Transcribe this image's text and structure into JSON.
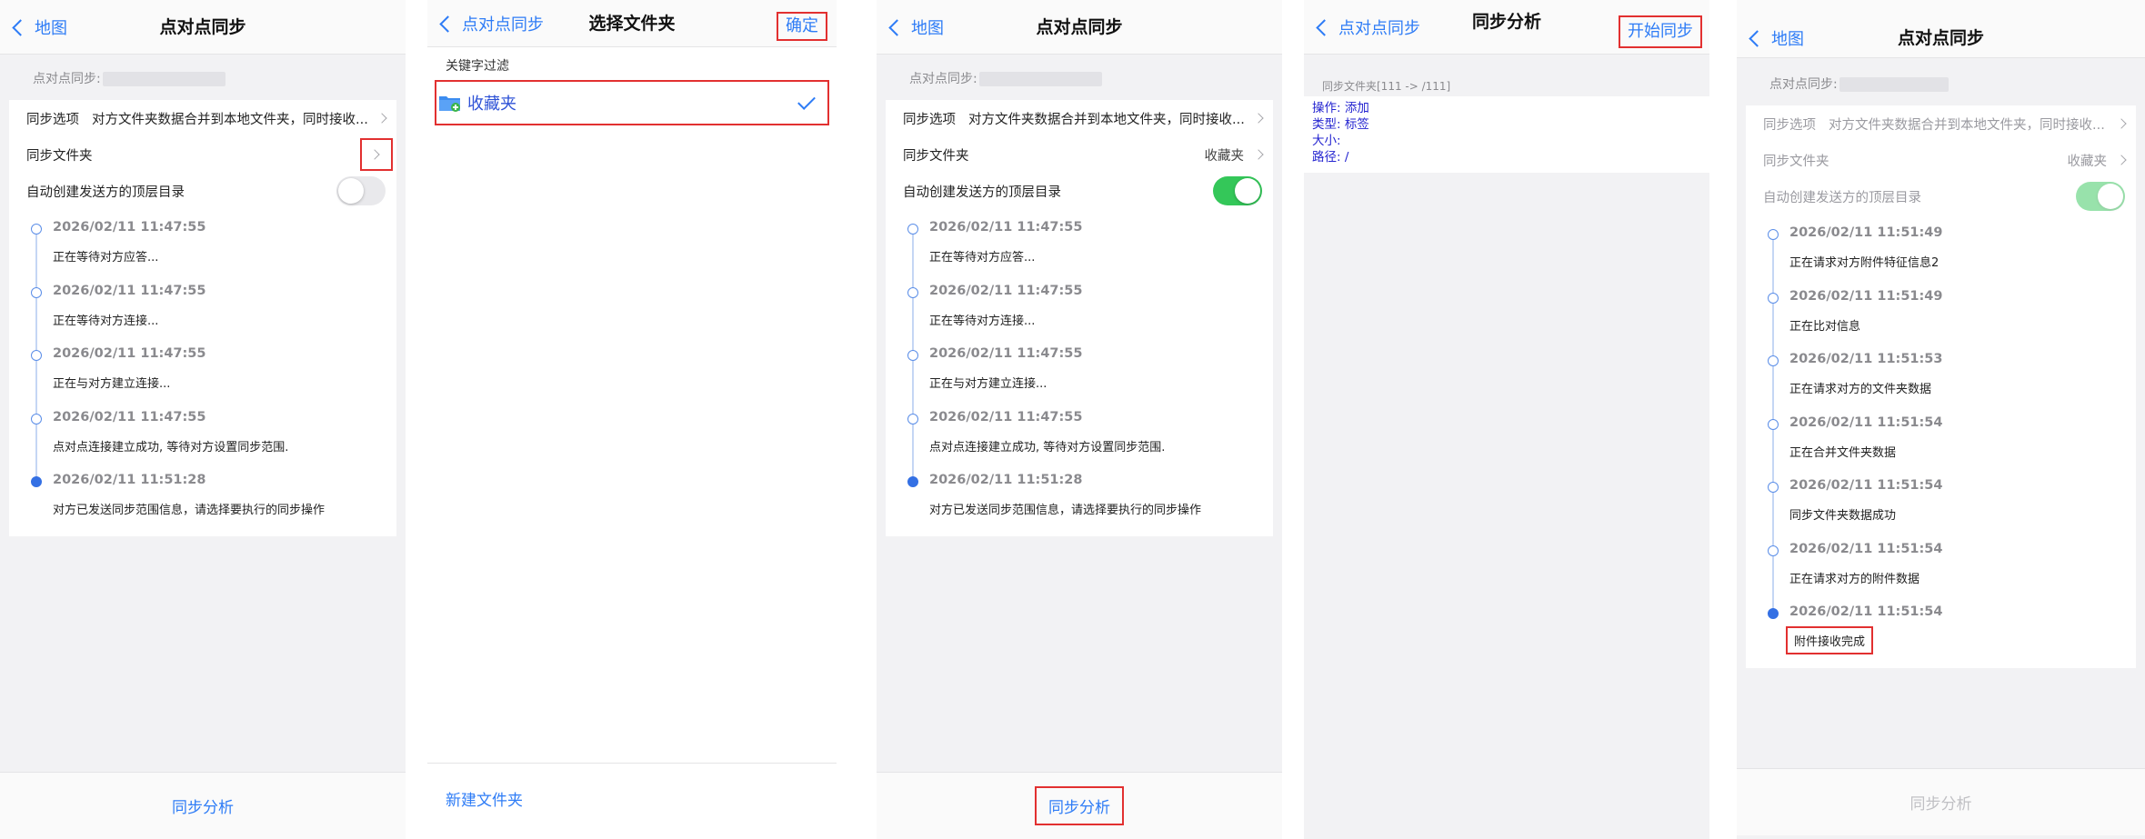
{
  "s1": {
    "back": "地图",
    "title": "点对点同步",
    "peer_label": "点对点同步:",
    "opt_label": "同步选项",
    "opt_value": "对方文件夹数据合并到本地文件夹，同时接收...",
    "folder_label": "同步文件夹",
    "auto_label": "自动创建发送方的顶层目录",
    "timeline": [
      {
        "time": "2026/02/11 11:47:55",
        "text": "正在等待对方应答..."
      },
      {
        "time": "2026/02/11 11:47:55",
        "text": "正在等待对方连接..."
      },
      {
        "time": "2026/02/11 11:47:55",
        "text": "正在与对方建立连接..."
      },
      {
        "time": "2026/02/11 11:47:55",
        "text": "点对点连接建立成功, 等待对方设置同步范围."
      },
      {
        "time": "2026/02/11 11:51:28",
        "text": "对方已发送同步范围信息，请选择要执行的同步操作"
      }
    ],
    "bottom": "同步分析"
  },
  "s2": {
    "back": "点对点同步",
    "title": "选择文件夹",
    "confirm": "确定",
    "filter": "关键字过滤",
    "folder": "收藏夹",
    "new_folder": "新建文件夹"
  },
  "s3": {
    "back": "地图",
    "title": "点对点同步",
    "peer_label": "点对点同步:",
    "opt_label": "同步选项",
    "opt_value": "对方文件夹数据合并到本地文件夹，同时接收...",
    "folder_label": "同步文件夹",
    "folder_value": "收藏夹",
    "auto_label": "自动创建发送方的顶层目录",
    "timeline": [
      {
        "time": "2026/02/11 11:47:55",
        "text": "正在等待对方应答..."
      },
      {
        "time": "2026/02/11 11:47:55",
        "text": "正在等待对方连接..."
      },
      {
        "time": "2026/02/11 11:47:55",
        "text": "正在与对方建立连接..."
      },
      {
        "time": "2026/02/11 11:47:55",
        "text": "点对点连接建立成功, 等待对方设置同步范围."
      },
      {
        "time": "2026/02/11 11:51:28",
        "text": "对方已发送同步范围信息，请选择要执行的同步操作"
      }
    ],
    "bottom": "同步分析"
  },
  "s4": {
    "back": "点对点同步",
    "title": "同步分析",
    "start": "开始同步",
    "sub": "同步文件夹[111 -> /111]",
    "lines": [
      "操作: 添加",
      "类型: 标签",
      "大小:",
      "路径: /"
    ]
  },
  "s5": {
    "back": "地图",
    "title": "点对点同步",
    "peer_label": "点对点同步:",
    "opt_label": "同步选项",
    "opt_value": "对方文件夹数据合并到本地文件夹，同时接收...",
    "folder_label": "同步文件夹",
    "folder_value": "收藏夹",
    "auto_label": "自动创建发送方的顶层目录",
    "timeline": [
      {
        "time": "2026/02/11 11:51:49",
        "text": "正在请求对方附件特征信息2"
      },
      {
        "time": "2026/02/11 11:51:49",
        "text": "正在比对信息"
      },
      {
        "time": "2026/02/11 11:51:53",
        "text": "正在请求对方的文件夹数据"
      },
      {
        "time": "2026/02/11 11:51:54",
        "text": "正在合并文件夹数据"
      },
      {
        "time": "2026/02/11 11:51:54",
        "text": "同步文件夹数据成功"
      },
      {
        "time": "2026/02/11 11:51:54",
        "text": "正在请求对方的附件数据"
      },
      {
        "time": "2026/02/11 11:51:54",
        "text": "附件接收完成"
      }
    ],
    "bottom": "同步分析"
  }
}
